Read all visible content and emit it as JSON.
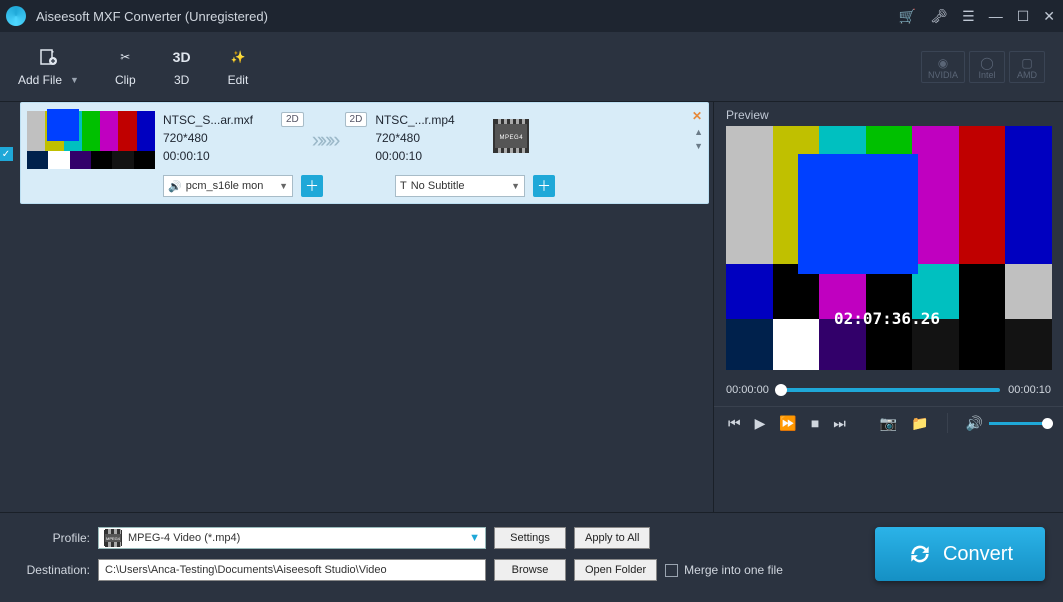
{
  "title": "Aiseesoft MXF Converter (Unregistered)",
  "toolbar": {
    "add_file": "Add File",
    "clip": "Clip",
    "three_d": "3D",
    "edit": "Edit"
  },
  "gpu": {
    "nvidia": "NVIDIA",
    "intel": "Intel",
    "amd": "AMD"
  },
  "file_item": {
    "source_name": "NTSC_S...ar.mxf",
    "source_dim": "720*480",
    "source_dur": "00:00:10",
    "source_tag": "2D",
    "arrows": "»»»",
    "dest_tag": "2D",
    "dest_name": "NTSC_...r.mp4",
    "dest_dim": "720*480",
    "dest_dur": "00:00:10",
    "dest_format": "MPEG4",
    "audio": "pcm_s16le mon",
    "subtitle": "No Subtitle"
  },
  "preview": {
    "label": "Preview",
    "timecode": "02:07:36.26",
    "t_start": "00:00:00",
    "t_end": "00:00:10"
  },
  "bottom": {
    "profile_label": "Profile:",
    "dest_label": "Destination:",
    "profile_value": "MPEG-4 Video (*.mp4)",
    "dest_value": "C:\\Users\\Anca-Testing\\Documents\\Aiseesoft Studio\\Video",
    "settings": "Settings",
    "apply_all": "Apply to All",
    "browse": "Browse",
    "open_folder": "Open Folder",
    "merge": "Merge into one file",
    "convert": "Convert"
  }
}
